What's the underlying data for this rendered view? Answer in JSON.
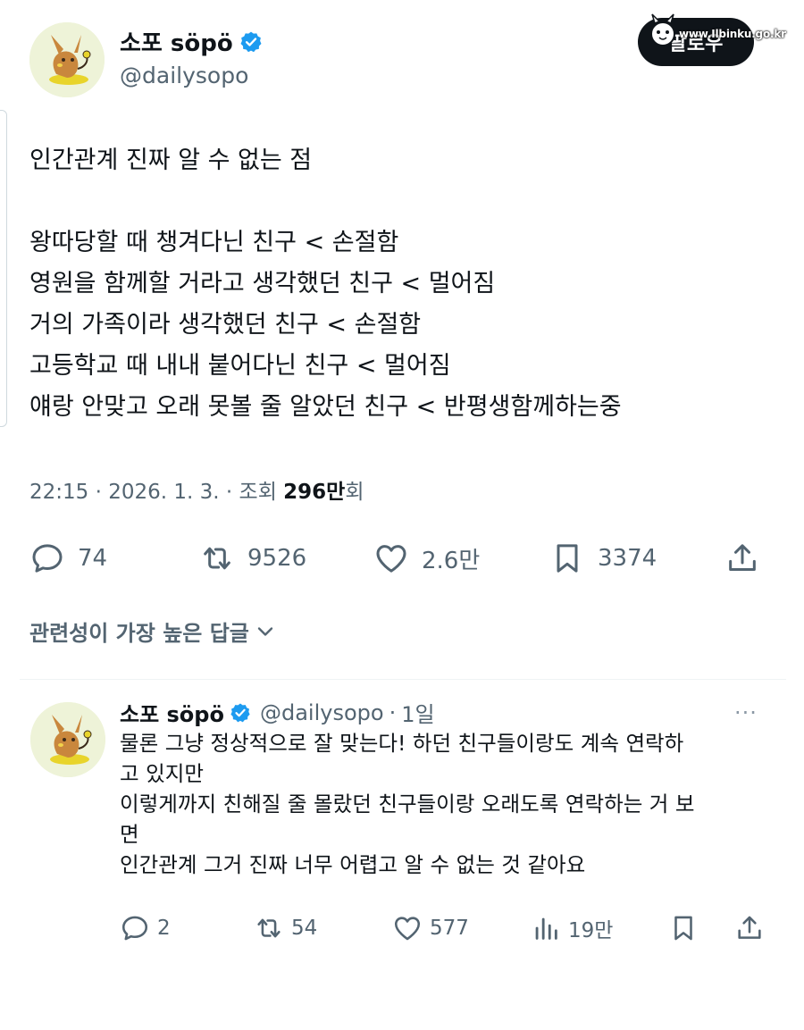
{
  "tweet": {
    "author": {
      "display_name": "소포 söpö",
      "handle": "@dailysopo",
      "verified": true
    },
    "follow_label": "팔로우",
    "watermark": "www.Ilbinku.go.kr",
    "lines": [
      "인간관계 진짜 알 수 없는 점",
      "",
      "왕따당할 때 챙겨다닌 친구 < 손절함",
      "영원을 함께할 거라고 생각했던 친구 < 멀어짐",
      "거의 가족이라 생각했던 친구 < 손절함",
      "고등학교 때 내내 붙어다닌 친구 < 멀어짐",
      "얘랑 안맞고 오래 못볼 줄 알았던 친구 < 반평생함께하는중"
    ],
    "meta": {
      "time": "22:15",
      "date": "2026. 1. 3.",
      "views_label": "조회",
      "views_count": "296만",
      "views_suffix": "회"
    },
    "stats": {
      "replies": "74",
      "retweets": "9526",
      "likes": "2.6만",
      "bookmarks": "3374"
    },
    "icons": [
      "reply-icon",
      "retweet-icon",
      "like-icon",
      "bookmark-icon",
      "share-icon"
    ]
  },
  "replies_sort": {
    "label": "관련성이 가장 높은 답글",
    "icon": "chevron-down-icon"
  },
  "reply": {
    "author": {
      "display_name": "소포 söpö",
      "handle": "@dailysopo",
      "verified": true
    },
    "separator": "·",
    "age": "1일",
    "more": "···",
    "lines": [
      "물론 그냥 정상적으로 잘 맞는다! 하던 친구들이랑도 계속 연락하",
      "고 있지만",
      "이렇게까지 친해질 줄 몰랐던 친구들이랑 오래도록 연락하는 거 보",
      "면",
      "인간관계 그거 진짜 너무 어렵고 알 수 없는 것 같아요"
    ],
    "stats": {
      "replies": "2",
      "retweets": "54",
      "likes": "577",
      "views": "19만"
    }
  },
  "colors": {
    "text": "#0f1419",
    "secondary": "#536471",
    "verified": "#1d9bf0",
    "button_bg": "#0f1419",
    "avatar_bg": "#eef3d8"
  }
}
